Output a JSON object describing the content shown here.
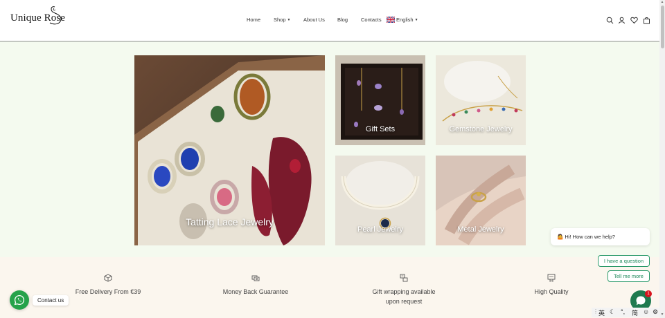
{
  "brand": {
    "name": "Unique Rose"
  },
  "nav": {
    "items": [
      {
        "label": "Home"
      },
      {
        "label": "Shop",
        "has_dropdown": true
      },
      {
        "label": "About Us"
      },
      {
        "label": "Blog"
      },
      {
        "label": "Contacts"
      }
    ],
    "language": {
      "label": "English",
      "flag": "uk-flag-icon"
    }
  },
  "header_icons": [
    "search-icon",
    "account-icon",
    "wishlist-icon",
    "cart-icon"
  ],
  "collections": [
    {
      "label": "Tatting Lace Jewelry"
    },
    {
      "label": "Gift Sets"
    },
    {
      "label": "Gemstone Jewelry"
    },
    {
      "label": "Pearl Jewelry"
    },
    {
      "label": "Metal Jewelry"
    }
  ],
  "features": [
    {
      "icon": "box-icon",
      "text": "Free Delivery From €39"
    },
    {
      "icon": "money-icon",
      "text": "Money Back Guarantee"
    },
    {
      "icon": "gift-icon",
      "text": "Gift wrapping available upon request"
    },
    {
      "icon": "quality-icon",
      "text": "High Quality"
    }
  ],
  "chat": {
    "greeting": "🤷 Hi! How can we help?",
    "quick_replies": [
      "I have a question",
      "Tell me more"
    ],
    "badge_count": "1"
  },
  "whatsapp": {
    "label": "Contact us"
  },
  "ime": {
    "items": [
      "英",
      "简"
    ]
  },
  "colors": {
    "page_bg": "#f4faef",
    "features_bg": "#fbf6ee",
    "chat_accent": "#1f8a5c",
    "whatsapp": "#25a24a",
    "badge": "#d8141e"
  }
}
